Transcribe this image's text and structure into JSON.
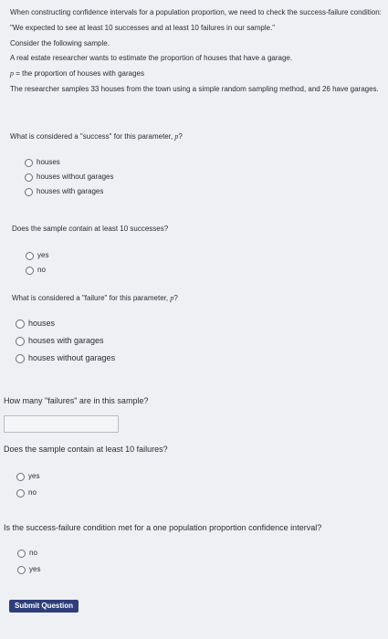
{
  "intro": {
    "line1": "When constructing confidence intervals for a population proportion, we need to check the success-failure condition:",
    "line2": "\"We expected to see at least 10 successes and at least 10 failures in our sample.\"",
    "line3": "Consider the following sample.",
    "line4": "A real estate researcher wants to estimate the proportion of houses that have a garage.",
    "p_symbol": "p",
    "line5": " = the proportion of houses with garages",
    "line6": "The researcher samples 33 houses from the town using a simple random sampling method, and 26 have garages."
  },
  "q1": {
    "text": "What is considered a \"success\" for this parameter, ",
    "p": "p",
    "suffix": "?",
    "options": [
      "houses",
      "houses without garages",
      "houses with garages"
    ]
  },
  "q2": {
    "text": "Does the sample contain at least 10 successes?",
    "options": [
      "yes",
      "no"
    ]
  },
  "q3": {
    "text": "What is considered a \"failure\" for this parameter, ",
    "p": "p",
    "suffix": "?",
    "options": [
      "houses",
      "houses with garages",
      "houses without garages"
    ]
  },
  "q4": {
    "text": "How many \"failures\" are in this sample?",
    "answer_value": ""
  },
  "q5": {
    "text": "Does the sample contain at least 10 failures?",
    "options": [
      "yes",
      "no"
    ]
  },
  "q6": {
    "text": "Is the success-failure condition met for a one population proportion confidence interval?",
    "options": [
      "no",
      "yes"
    ]
  },
  "submit_label": "Submit Question"
}
